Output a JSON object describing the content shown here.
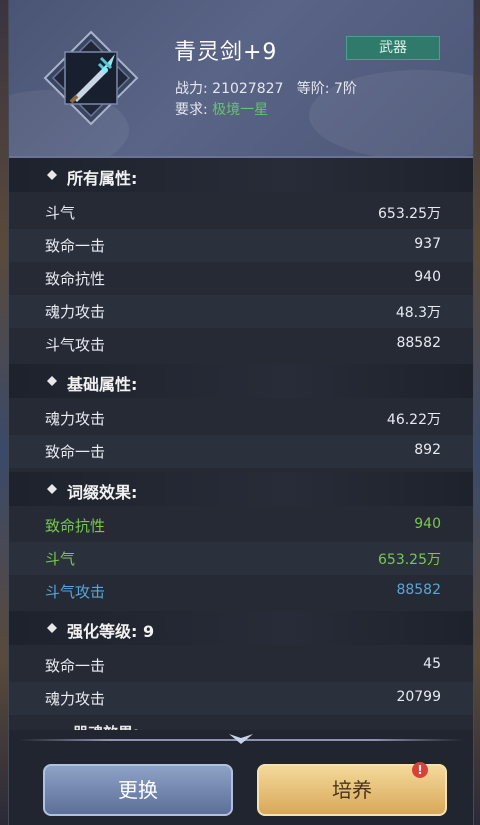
{
  "item": {
    "name": "青灵剑+9",
    "type": "武器",
    "power_label": "战力:",
    "power": "21027827",
    "grade_label": "等阶:",
    "grade": "7阶",
    "req_label": "要求:",
    "requirement": "极境一星"
  },
  "sections": {
    "all": {
      "title": "所有属性:",
      "rows": [
        {
          "label": "斗气",
          "value": "653.25万"
        },
        {
          "label": "致命一击",
          "value": "937"
        },
        {
          "label": "致命抗性",
          "value": "940"
        },
        {
          "label": "魂力攻击",
          "value": "48.3万"
        },
        {
          "label": "斗气攻击",
          "value": "88582"
        }
      ]
    },
    "base": {
      "title": "基础属性:",
      "rows": [
        {
          "label": "魂力攻击",
          "value": "46.22万"
        },
        {
          "label": "致命一击",
          "value": "892"
        }
      ]
    },
    "affix": {
      "title": "词缀效果:",
      "rows": [
        {
          "label": "致命抗性",
          "value": "940"
        },
        {
          "label": "斗气",
          "value": "653.25万"
        },
        {
          "label": "斗气攻击",
          "value": "88582"
        }
      ]
    },
    "enhance": {
      "title": "强化等级: 9",
      "rows": [
        {
          "label": "致命一击",
          "value": "45"
        },
        {
          "label": "魂力攻击",
          "value": "20799"
        }
      ]
    },
    "partial_title": "器魂效果:"
  },
  "buttons": {
    "swap": "更换",
    "upgrade": "培养",
    "alert": "!"
  },
  "colors": {
    "green": "#79c94e",
    "blue": "#5aa6d8",
    "badge": "#2f7a6a"
  },
  "icons": [
    "sword-icon",
    "diamond-icon",
    "alert-icon"
  ]
}
